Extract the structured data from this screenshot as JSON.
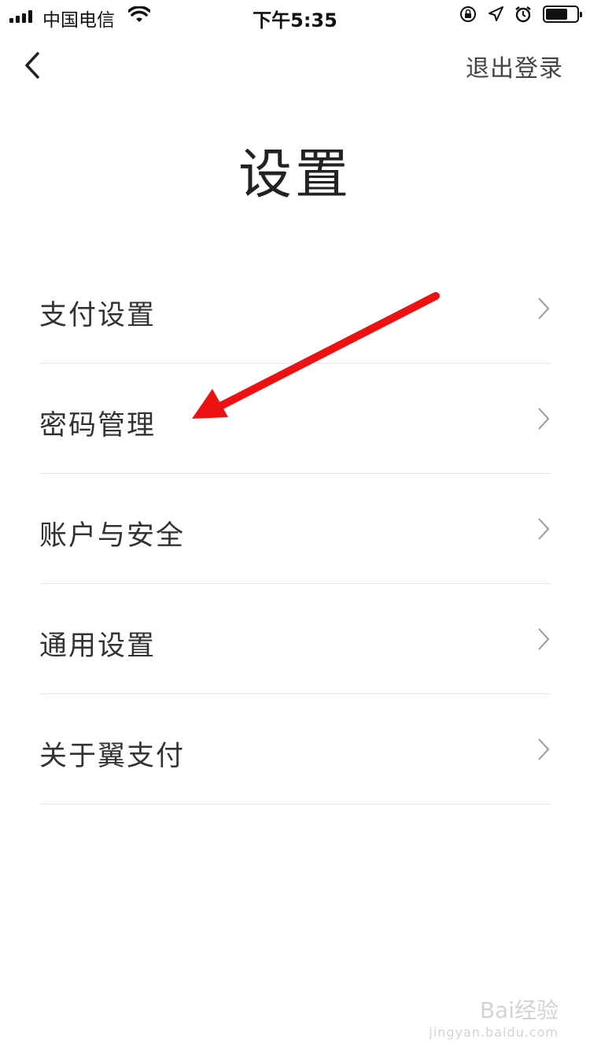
{
  "status_bar": {
    "carrier": "中国电信",
    "time": "下午5:35"
  },
  "nav": {
    "logout_label": "退出登录"
  },
  "page": {
    "title": "设置"
  },
  "menu": {
    "items": [
      {
        "label": "支付设置"
      },
      {
        "label": "密码管理"
      },
      {
        "label": "账户与安全"
      },
      {
        "label": "通用设置"
      },
      {
        "label": "关于翼支付"
      }
    ]
  },
  "watermark": {
    "brand": "Bai经验",
    "url": "jingyan.baidu.com"
  },
  "colors": {
    "annotation_arrow": "#ee1111",
    "divider": "#e6e6e6",
    "text": "#333333"
  },
  "icons": [
    "signal-icon",
    "wifi-icon",
    "orientation-lock-icon",
    "location-icon",
    "alarm-icon",
    "battery-icon",
    "back-arrow-icon",
    "chevron-right-icon"
  ]
}
